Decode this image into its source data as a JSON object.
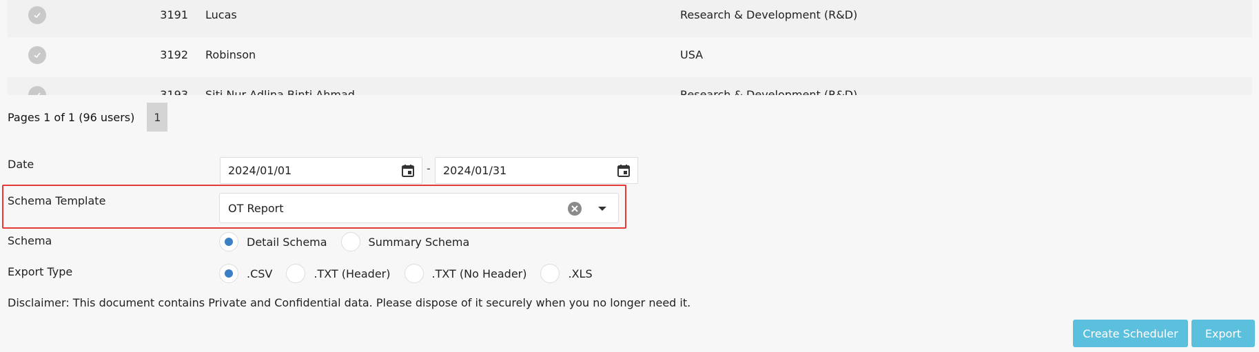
{
  "table": {
    "rows": [
      {
        "id": "3191",
        "name": "Lucas",
        "department": "Research & Development (R&D)"
      },
      {
        "id": "3192",
        "name": "Robinson",
        "department": "USA"
      },
      {
        "id": "3193",
        "name": "Siti Nur Adlina Binti Ahmad",
        "department": "Research & Development (R&D)"
      }
    ]
  },
  "pager": {
    "info": "Pages 1 of 1 (96 users)",
    "current_page": "1"
  },
  "form": {
    "date_label": "Date",
    "date_from": "2024/01/01",
    "date_separator": "-",
    "date_to": "2024/01/31",
    "schema_template_label": "Schema Template",
    "schema_template_value": "OT Report",
    "schema_label": "Schema",
    "schema_options": [
      "Detail Schema",
      "Summary Schema"
    ],
    "schema_selected": "Detail Schema",
    "export_type_label": "Export Type",
    "export_options": [
      ".CSV",
      ".TXT (Header)",
      ".TXT (No Header)",
      ".XLS"
    ],
    "export_selected": ".CSV"
  },
  "disclaimer": "Disclaimer: This document contains Private and Confidential data. Please dispose of it securely when you no longer need it.",
  "buttons": {
    "create_scheduler": "Create Scheduler",
    "export": "Export"
  },
  "colors": {
    "accent_button": "#5bc0de",
    "radio_selected": "#3b7fc4",
    "highlight_border": "#e53935"
  }
}
